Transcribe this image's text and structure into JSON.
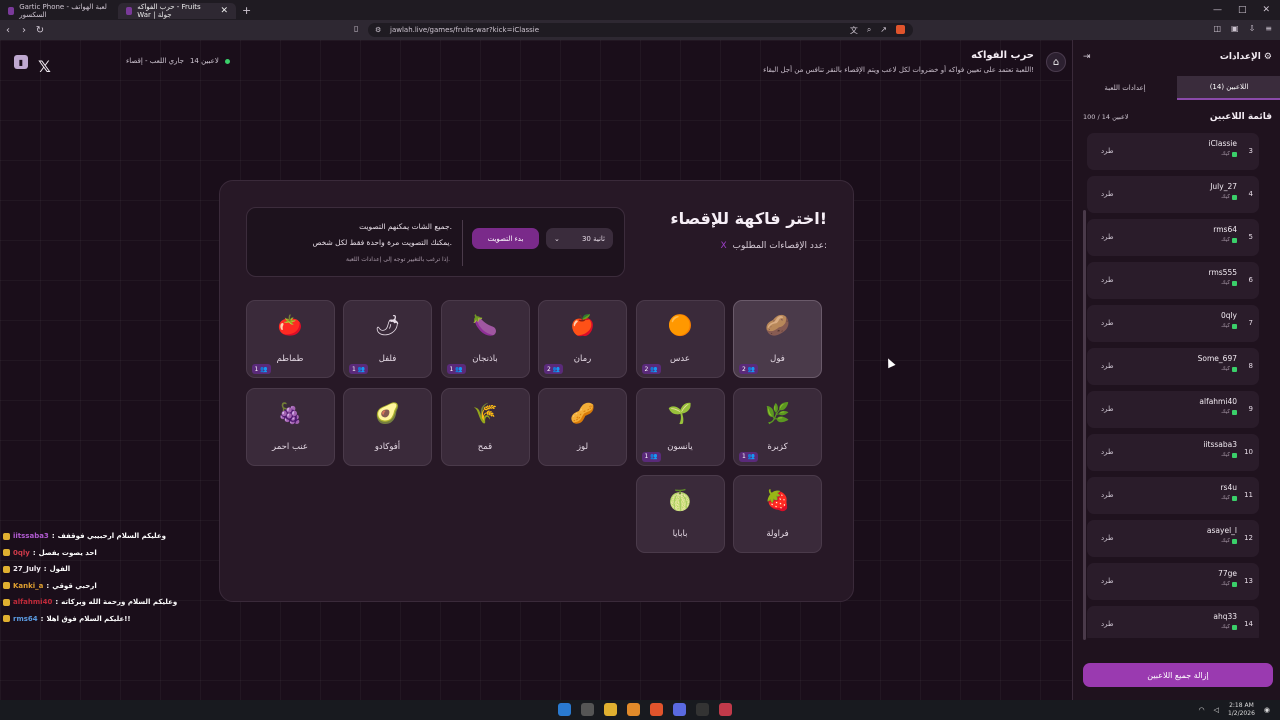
{
  "browser": {
    "tabs": [
      {
        "label": "Gartic Phone - لعبة الهواتف السكسور"
      },
      {
        "label": "حرب الفواكه - Fruits War | جولة"
      }
    ],
    "url": "jawlah.live/games/fruits-war?kick=iClassie"
  },
  "header": {
    "title": "حرب الفواكه",
    "subtitle": "اللعبة تعتمد على تعيين فواكه أو خضروات لكل لاعب ويتم الإقصاء بالنقر تنافس من أجل البقاء!",
    "status_players": "14 لاعبين",
    "status_game": "جاري اللعب - إقصاء",
    "status_color": "#3ad06a"
  },
  "card": {
    "title": "اختر فاكهة للإقصاء!",
    "required_label": "عدد الإقصاءات المطلوب:",
    "required_value": "X",
    "vote_line1": "جميع الشات يمكنهم التصويت.",
    "vote_line2": "يمكنك التصويت مرة واحدة فقط لكل شخص.",
    "vote_line3": "إذا ترغب بالتغيير توجه إلى إعدادات اللعبة.",
    "vote_button": "بدء التصويت",
    "time_select": "30 ثانية"
  },
  "fruits": [
    {
      "name": "فول",
      "icon": "🥔",
      "count": "2",
      "selected": true
    },
    {
      "name": "عدس",
      "icon": "🟠",
      "count": "2"
    },
    {
      "name": "رمان",
      "icon": "🍎",
      "count": "2"
    },
    {
      "name": "باذنجان",
      "icon": "🍆",
      "count": "1"
    },
    {
      "name": "فلفل",
      "icon": "🌶",
      "count": "1"
    },
    {
      "name": "طماطم",
      "icon": "🍅",
      "count": "1"
    },
    {
      "name": "كزبرة",
      "icon": "🌿",
      "count": "1"
    },
    {
      "name": "يانسون",
      "icon": "🌱",
      "count": "1"
    },
    {
      "name": "لوز",
      "icon": "🥜",
      "count": ""
    },
    {
      "name": "قمح",
      "icon": "🌾",
      "count": ""
    },
    {
      "name": "أفوكادو",
      "icon": "🥑",
      "count": ""
    },
    {
      "name": "عنب احمر",
      "icon": "🍇",
      "count": ""
    },
    {
      "name": "فراولة",
      "icon": "🍓",
      "count": ""
    },
    {
      "name": "بابايا",
      "icon": "🍈",
      "count": ""
    }
  ],
  "chat": [
    {
      "user": "iitssaba3",
      "text": "وعليكم السلام ارحبيبي فوقفف",
      "color": "#b05ad0"
    },
    {
      "user": "0qly",
      "text": "احد يصوت يفصل",
      "color": "#d03a4a"
    },
    {
      "user": "27_July",
      "text": "الفول",
      "color": "#f3ecf3"
    },
    {
      "user": "Kanki_a",
      "text": "ارحبي قوقي",
      "color": "#e0a030"
    },
    {
      "user": "alfahmi40",
      "text": "وعليكم السلام ورحمة الله وبركاته",
      "color": "#c02a3a"
    },
    {
      "user": "rms64",
      "text": "عليكم السلام فوق اهلا!!",
      "color": "#5a9ae0"
    }
  ],
  "panel": {
    "title": "الإعدادات",
    "tab_players": "اللاعبين (14)",
    "tab_settings": "إعدادات اللعبة",
    "list_title": "قائمة اللاعبين",
    "count": "100 / 14 لاعبين",
    "kick_label": "طرد",
    "role_label": "كيك",
    "remove_all": "إزالة جميع اللاعبين",
    "players": [
      {
        "num": "3",
        "name": "iClassie"
      },
      {
        "num": "4",
        "name": "July_27"
      },
      {
        "num": "5",
        "name": "rms64"
      },
      {
        "num": "6",
        "name": "rms555"
      },
      {
        "num": "7",
        "name": "0qly"
      },
      {
        "num": "8",
        "name": "Some_697"
      },
      {
        "num": "9",
        "name": "alfahmi40"
      },
      {
        "num": "10",
        "name": "iitssaba3"
      },
      {
        "num": "11",
        "name": "rs4u"
      },
      {
        "num": "12",
        "name": "asayel_l"
      },
      {
        "num": "13",
        "name": "77ge"
      },
      {
        "num": "14",
        "name": "ahq33"
      }
    ]
  },
  "taskbar": {
    "time": "2:18 AM",
    "date": "1/2/2026"
  }
}
